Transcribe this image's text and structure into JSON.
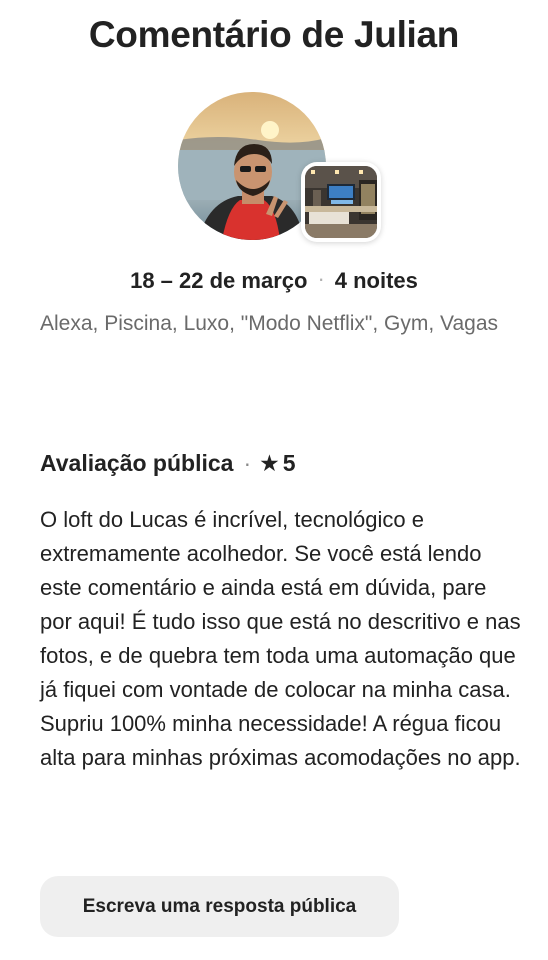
{
  "header": {
    "title": "Comentário de Julian"
  },
  "reviewer": {
    "avatar_icon": "reviewer-avatar-photo",
    "listing_icon": "listing-thumbnail-photo"
  },
  "stay": {
    "dates": "18 – 22 de março",
    "separator": "·",
    "nights": "4 noites"
  },
  "listing": {
    "amenities": "Alexa, Piscina, Luxo, \"Modo Netflix\", Gym, Vagas"
  },
  "review": {
    "heading": "Avaliação pública",
    "separator": "·",
    "star_icon": "★",
    "rating": "5",
    "text": "O loft do Lucas é incrível, tecnológico e extremamente acolhedor. Se você está lendo este comentário e ainda está em dúvida, pare por aqui! É tudo isso que está no descritivo e nas fotos, e de quebra tem toda uma automação que já fiquei com vontade de colocar na minha casa. Supriu 100% minha necessidade! A régua ficou alta para minhas próximas acomodações no app."
  },
  "actions": {
    "reply_label": "Escreva uma resposta pública"
  },
  "colors": {
    "text_primary": "#222222",
    "text_secondary": "#6a6a6a",
    "button_bg": "#efefef"
  }
}
